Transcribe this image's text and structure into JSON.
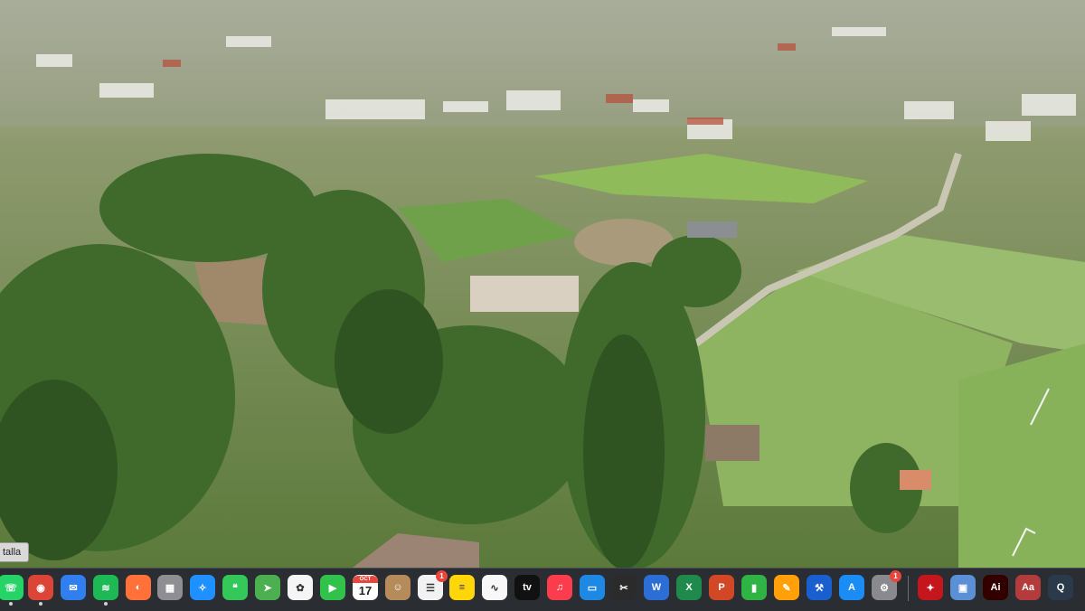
{
  "tooltip": {
    "text": "talla"
  },
  "wallpaper": {
    "description_icon": "aerial-landscape"
  },
  "calendar": {
    "month": "OCT",
    "day": "17"
  },
  "dock": {
    "background": "#2a2d31",
    "items": [
      {
        "name": "whatsapp",
        "icon": "whatsapp-icon",
        "glyph": "☏",
        "color": "#25d366",
        "running": true
      },
      {
        "name": "chrome",
        "icon": "chrome-icon",
        "glyph": "◉",
        "color": "#db4437",
        "running": true
      },
      {
        "name": "mail",
        "icon": "mail-icon",
        "glyph": "✉",
        "color": "#2f7ff0",
        "running": false
      },
      {
        "name": "spotify",
        "icon": "spotify-icon",
        "glyph": "≋",
        "color": "#1db954",
        "running": true
      },
      {
        "name": "firefox",
        "icon": "firefox-icon",
        "glyph": "◐",
        "color": "#ff7139",
        "running": false
      },
      {
        "name": "launchpad",
        "icon": "launchpad-icon",
        "glyph": "▦",
        "color": "#8e8e93",
        "running": false
      },
      {
        "name": "safari",
        "icon": "safari-icon",
        "glyph": "✧",
        "color": "#1e90ff",
        "running": false
      },
      {
        "name": "messages",
        "icon": "messages-icon",
        "glyph": "❝",
        "color": "#34c759",
        "running": false
      },
      {
        "name": "maps",
        "icon": "maps-icon",
        "glyph": "➤",
        "color": "#4caf50",
        "running": false
      },
      {
        "name": "photos",
        "icon": "photos-icon",
        "glyph": "✿",
        "color": "#f5f5f5",
        "running": false
      },
      {
        "name": "facetime",
        "icon": "facetime-icon",
        "glyph": "▶",
        "color": "#30c24b",
        "running": false
      },
      {
        "name": "calendar",
        "icon": "calendar-icon",
        "glyph": "",
        "color": "#ffffff",
        "running": false
      },
      {
        "name": "contacts",
        "icon": "contacts-icon",
        "glyph": "☺",
        "color": "#b58b5a",
        "running": false
      },
      {
        "name": "reminders",
        "icon": "reminders-icon",
        "glyph": "☰",
        "color": "#f2f2f2",
        "running": false,
        "badge": "1"
      },
      {
        "name": "notes",
        "icon": "notes-icon",
        "glyph": "≡",
        "color": "#ffd60a",
        "running": false
      },
      {
        "name": "freeform",
        "icon": "freeform-icon",
        "glyph": "∿",
        "color": "#f8f8f8",
        "running": false
      },
      {
        "name": "apple-tv",
        "icon": "apple-tv-icon",
        "glyph": "tv",
        "color": "#111111",
        "running": false
      },
      {
        "name": "music",
        "icon": "music-icon",
        "glyph": "♫",
        "color": "#fa3c4c",
        "running": false
      },
      {
        "name": "keynote",
        "icon": "keynote-icon",
        "glyph": "▭",
        "color": "#1e88e5",
        "running": false
      },
      {
        "name": "final-cut",
        "icon": "clapper-icon",
        "glyph": "✂",
        "color": "#2b2b2b",
        "running": false
      },
      {
        "name": "word",
        "icon": "word-icon",
        "glyph": "W",
        "color": "#2b6fd6",
        "running": false
      },
      {
        "name": "excel",
        "icon": "excel-icon",
        "glyph": "X",
        "color": "#1f8a4c",
        "running": false
      },
      {
        "name": "powerpoint",
        "icon": "powerpoint-icon",
        "glyph": "P",
        "color": "#d24726",
        "running": false
      },
      {
        "name": "numbers",
        "icon": "numbers-icon",
        "glyph": "▮",
        "color": "#2fb344",
        "running": false
      },
      {
        "name": "pages",
        "icon": "pages-icon",
        "glyph": "✎",
        "color": "#ff9f0a",
        "running": false
      },
      {
        "name": "xcode",
        "icon": "xcode-icon",
        "glyph": "⚒",
        "color": "#1a5fd0",
        "running": false
      },
      {
        "name": "app-store",
        "icon": "app-store-icon",
        "glyph": "A",
        "color": "#1c8cf5",
        "running": false
      },
      {
        "name": "system-settings",
        "icon": "settings-icon",
        "glyph": "⚙",
        "color": "#8a8a8e",
        "running": false,
        "badge": "1"
      },
      {
        "name": "acrobat",
        "icon": "acrobat-icon",
        "glyph": "✦",
        "color": "#c4161c",
        "running": false
      },
      {
        "name": "preview",
        "icon": "preview-icon",
        "glyph": "▣",
        "color": "#5b8fd6",
        "running": false
      },
      {
        "name": "illustrator",
        "icon": "illustrator-icon",
        "glyph": "Ai",
        "color": "#330000",
        "running": false
      },
      {
        "name": "dictionary",
        "icon": "dictionary-icon",
        "glyph": "Aa",
        "color": "#b33b3b",
        "running": false
      },
      {
        "name": "quicktime",
        "icon": "quicktime-icon",
        "glyph": "Q",
        "color": "#2b3a4a",
        "running": false
      }
    ]
  }
}
